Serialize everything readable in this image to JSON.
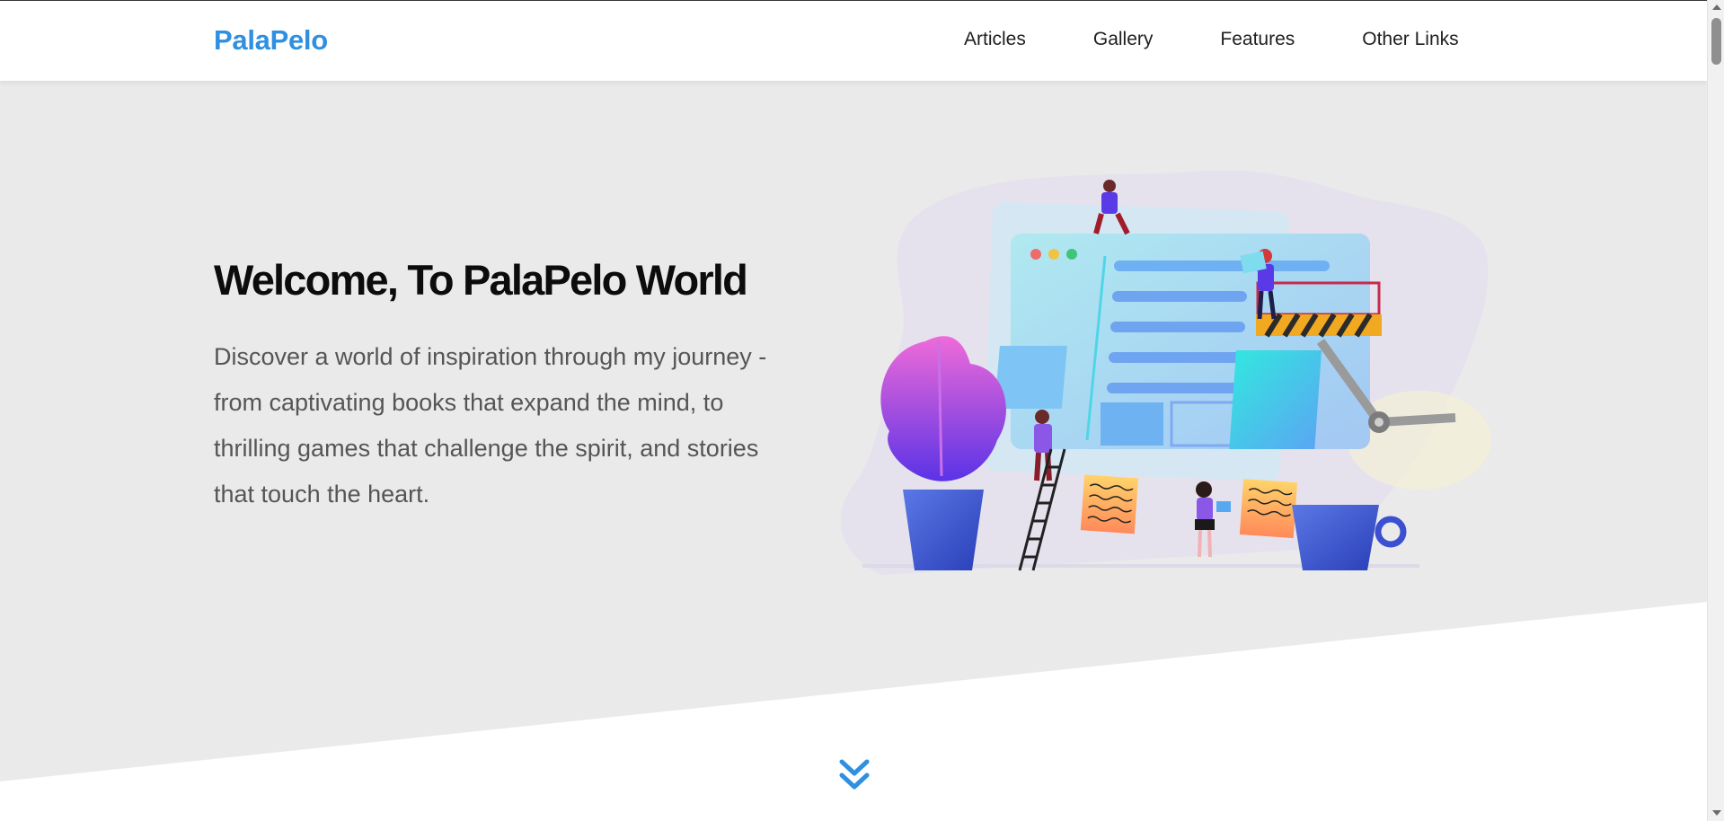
{
  "header": {
    "logo": "PalaPelo",
    "nav": [
      {
        "label": "Articles"
      },
      {
        "label": "Gallery"
      },
      {
        "label": "Features"
      },
      {
        "label": "Other Links"
      }
    ]
  },
  "hero": {
    "title": "Welcome, To PalaPelo World",
    "description": "Discover a world of inspiration through my journey - from captivating books that expand the mind, to thrilling games that challenge the spirit, and stories that touch the heart.",
    "illustration_icon": "website-construction-illustration",
    "scroll_icon": "double-chevron-down-icon"
  },
  "colors": {
    "brand": "#2f8fe0",
    "hero_background": "#eaeaea",
    "text_dark": "#0c0c0c",
    "text_muted": "#555555"
  }
}
